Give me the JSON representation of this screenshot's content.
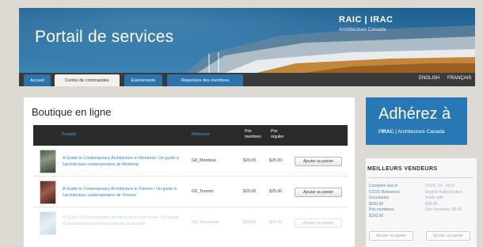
{
  "header": {
    "portal_title": "Portail de services",
    "logo_text": "RAIC | IRAC",
    "logo_subtitle": "Architecture Canada",
    "colors": {
      "banner": "#2a6fa0",
      "nav": "#3a3a3a",
      "tab": "#2b73ad"
    }
  },
  "nav": {
    "tabs": [
      {
        "label": "Accueil"
      },
      {
        "label": "Centre de commandes"
      },
      {
        "label": "Événements"
      },
      {
        "label": "Répertoire des membres"
      }
    ],
    "active_tab": "Centre de commandes",
    "languages": [
      "ENGLISH",
      "FRANÇAIS"
    ]
  },
  "shop": {
    "title": "Boutique en ligne",
    "columns": {
      "products": "Produits",
      "reference": "Référence",
      "member_price": "Prix membres",
      "regular_price": "Prix régulier"
    },
    "add_to_cart_label": "Ajouter au panier",
    "rows": [
      {
        "title": "A Guide to Contemporary Architecture in Montreal / Un guide à l'architecture contemporaine de Montréal",
        "reference": "G8_Montreal",
        "member_price": "$20.00",
        "regular_price": "$25.00"
      },
      {
        "title": "A Guide to Contemporary Architecture in Toronto / Un guide à l'architecture contemporaine de Toronto",
        "reference": "G0_Toronto",
        "member_price": "$20.00",
        "regular_price": "$25.00"
      },
      {
        "title": "A Guide to Contemporary Architecture in Vancouver / Un guide à l'architecture contemporaine de Vancouver",
        "reference": "G8_Vancouver",
        "member_price": "$20.00",
        "regular_price": "$25.00"
      }
    ]
  },
  "sidebar": {
    "join_title": "Adhérez à",
    "join_brand": "l'IRAC",
    "join_subtitle": "| Architecture Canada",
    "best_sellers_title": "MEILLEURS VENDEURS",
    "best_sellers": [
      {
        "lines": [
          "Complete Set of",
          "CCDC Reference",
          "Documents",
          "$200.00",
          "Prix membres:",
          "$150.00"
        ],
        "button": "Ajouter au panier"
      },
      {
        "lines": [
          "CCDC 14 - 2013",
          "English Authorization",
          "Seals with",
          "$18.00",
          "Prix membres: $9.00"
        ],
        "button": "Ajouter au panier"
      }
    ]
  }
}
